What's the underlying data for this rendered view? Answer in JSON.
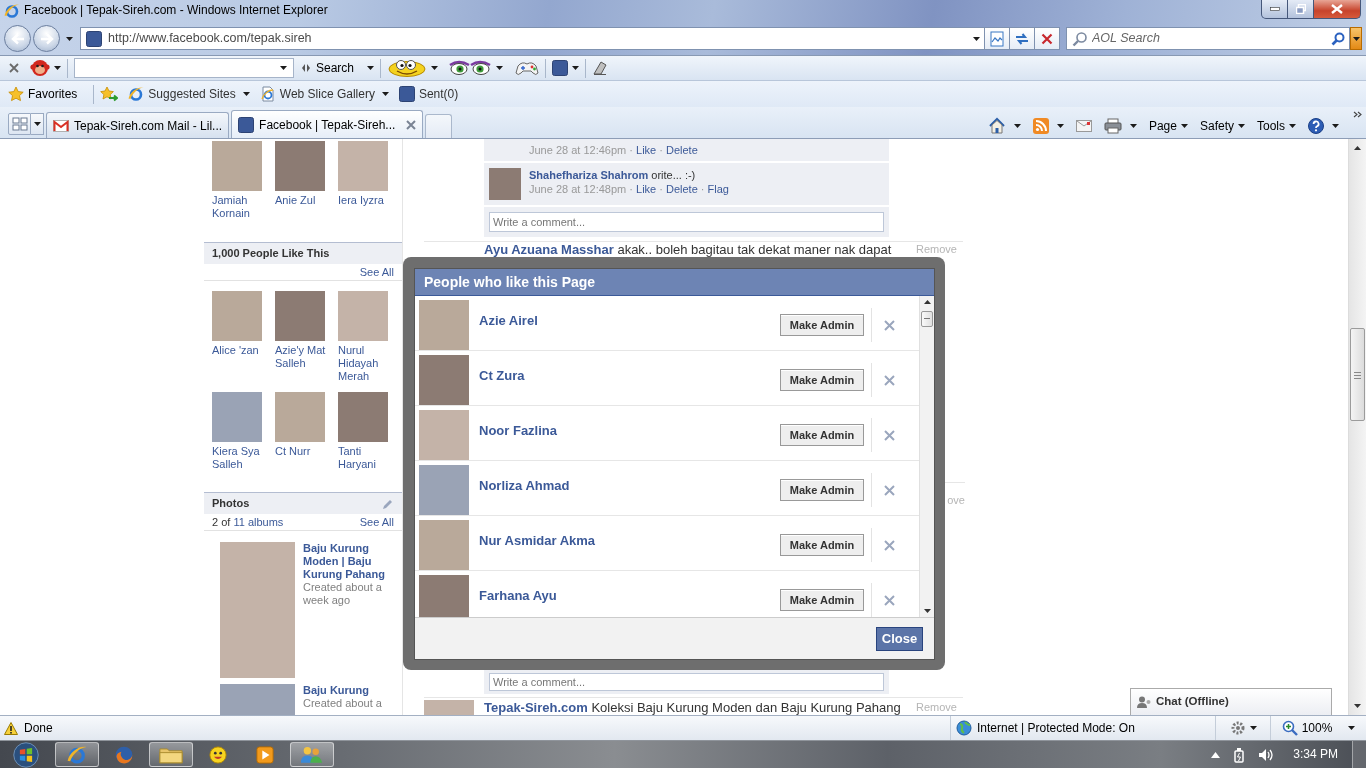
{
  "window": {
    "title": "Facebook | Tepak-Sireh.com - Windows Internet Explorer"
  },
  "address_bar": {
    "url": "http://www.facebook.com/tepak.sireh",
    "search_placeholder": "AOL Search"
  },
  "aol_toolbar": {
    "search_button": "Search"
  },
  "favorites_bar": {
    "favorites": "Favorites",
    "links": [
      {
        "label": "Suggested Sites",
        "kind": "sites",
        "dropdown": true
      },
      {
        "label": "Web Slice Gallery",
        "kind": "slices",
        "dropdown": true
      },
      {
        "label": "Sent(0)",
        "kind": "social",
        "dropdown": false
      }
    ]
  },
  "tabs": [
    {
      "label": "Tepak-Sireh.com Mail - Lil...",
      "kind": "mail",
      "selected": false
    },
    {
      "label": "Facebook | Tepak-Sireh...",
      "kind": "social",
      "selected": true
    }
  ],
  "command_bar": [
    "Page",
    "Safety",
    "Tools"
  ],
  "sidebar": {
    "friends": [
      "Jamiah Kornain",
      "Anie Zul",
      "Iera Iyzra"
    ],
    "likes": {
      "title": "1,000 People Like This",
      "see_all": "See All",
      "people": [
        "Alice 'zan",
        "Azie'y Mat Salleh",
        "Nurul Hidayah Merah",
        "Kiera Sya Salleh",
        "Ct Nurr",
        "Tanti Haryani"
      ]
    },
    "photos": {
      "title": "Photos",
      "count": "2 of",
      "albums_link": "11 albums",
      "see_all": "See All",
      "albums": [
        {
          "title": "Baju Kurung Moden | Baju Kurung Pahang",
          "meta": "Created about a week ago"
        },
        {
          "title": "Baju Kurung",
          "meta": "Created about a"
        }
      ]
    }
  },
  "feed": {
    "separator": "·",
    "above_dialog": [
      {
        "kind": "comment",
        "time": "June 28 at 12:46pm",
        "links": [
          "Like",
          "Delete"
        ]
      },
      {
        "kind": "comment",
        "author": "Shahefhariza Shahrom",
        "text": "orite... :-)",
        "time": "June 28 at 12:48pm",
        "links": [
          "Like",
          "Delete",
          "Flag"
        ]
      },
      {
        "kind": "comment_box",
        "placeholder": "Write a comment..."
      },
      {
        "kind": "post",
        "author": "Ayu Azuana Masshar",
        "text": "akak.. boleh bagitau tak dekat maner nak dapat",
        "action": "Remove"
      }
    ],
    "beside_dialog": [
      {
        "kind": "post",
        "action": "ove"
      }
    ],
    "below_dialog": [
      {
        "kind": "comment_box",
        "placeholder": "Write a comment..."
      },
      {
        "kind": "post",
        "photo": true,
        "author": "Tepak-Sireh.com",
        "text": "Koleksi Baju Kurung Moden dan Baju Kurung Pahang",
        "action": "Remove"
      }
    ]
  },
  "likes_dialog": {
    "title": "People who like this Page",
    "people": [
      {
        "name": "Azie Airel",
        "button": "Make Admin"
      },
      {
        "name": "Ct Zura",
        "button": "Make Admin"
      },
      {
        "name": "Noor Fazlina",
        "button": "Make Admin"
      },
      {
        "name": "Norliza Ahmad",
        "button": "Make Admin"
      },
      {
        "name": "Nur Asmidar Akma",
        "button": "Make Admin"
      },
      {
        "name": "Farhana Ayu",
        "button": "Make Admin"
      }
    ],
    "close_button": "Close"
  },
  "chat": {
    "label": "Chat (Offline)"
  },
  "status_bar": {
    "text": "Done",
    "zone": "Internet | Protected Mode: On",
    "zoom": "100%"
  },
  "taskbar": {
    "apps": [
      {
        "kind": "browser",
        "running": true
      },
      {
        "kind": "fireglobe",
        "running": false
      },
      {
        "kind": "folder",
        "running": true
      },
      {
        "kind": "smiley",
        "running": false
      },
      {
        "kind": "player",
        "running": false
      },
      {
        "kind": "people",
        "running": true
      }
    ],
    "clock": "3:34 PM"
  }
}
